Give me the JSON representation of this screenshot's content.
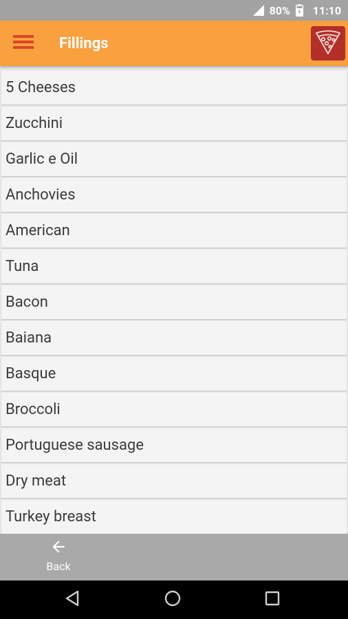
{
  "status_bar": {
    "battery_percent": "80%",
    "time": "11:10",
    "icons": [
      "signal-icon",
      "battery-icon"
    ]
  },
  "app_bar": {
    "title": "Fillings",
    "menu_icon": "hamburger-menu-icon",
    "logo_icon": "pizza-slice-icon"
  },
  "fillings": [
    "5 Cheeses",
    "Zucchini",
    "Garlic e Oil",
    "Anchovies",
    "American",
    "Tuna",
    "Bacon",
    "Baiana",
    "Basque",
    "Broccoli",
    "Portuguese sausage",
    "Dry meat",
    "Turkey breast"
  ],
  "bottom_bar": {
    "back_label": "Back",
    "back_icon": "arrow-left-icon"
  },
  "nav_bar": {
    "icons": [
      "nav-back-icon",
      "nav-home-icon",
      "nav-recents-icon"
    ]
  },
  "colors": {
    "app_bar": "#f9a03f",
    "menu_icon": "#d9462a",
    "logo_bg": "#b32f28",
    "status_bar": "#a3a3a3",
    "bottom_bar": "#a9a9a9",
    "list_item_bg": "#f4f4f4",
    "list_text": "#3b3b3b"
  }
}
